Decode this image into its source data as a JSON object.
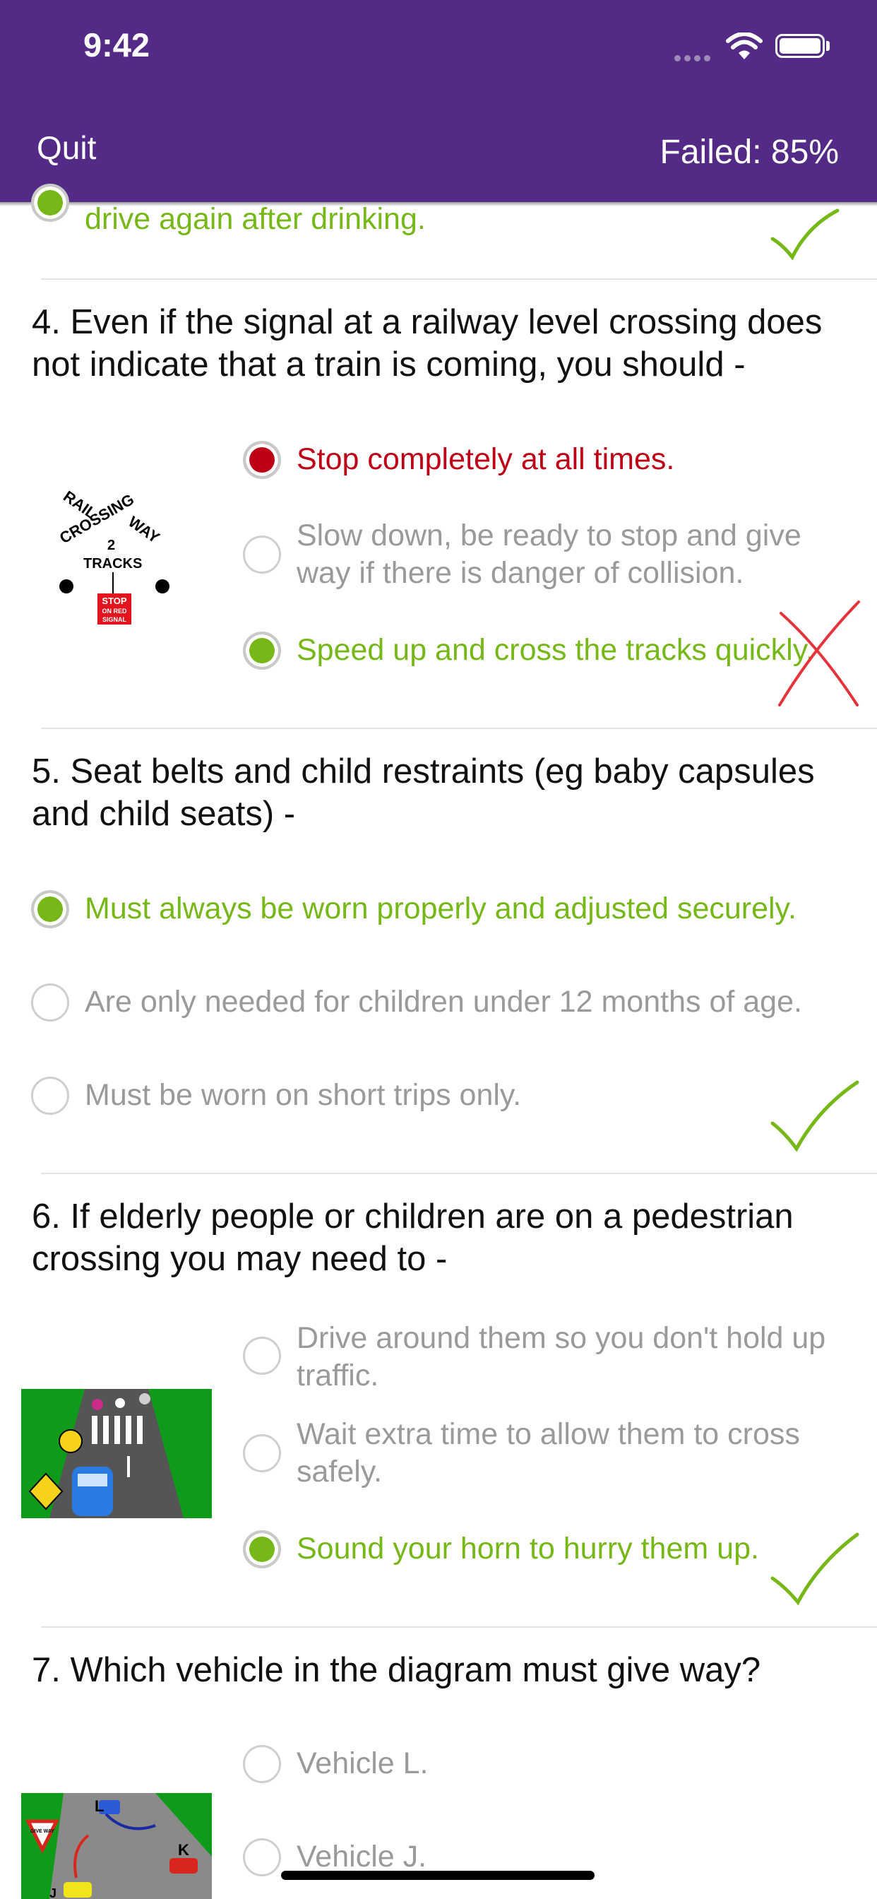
{
  "status": {
    "time": "9:42"
  },
  "header": {
    "quit": "Quit",
    "failed": "Failed: 85%"
  },
  "questions": [
    {
      "partial_answer": "drive again after drinking.",
      "mark": "tick"
    },
    {
      "text": "4. Even if the signal at a railway level crossing does not indicate that a train is coming, you should -",
      "image": {
        "line1": "RAIL",
        "line2": "CROSSING",
        "line3": "WAY",
        "line4": "2",
        "line5": "TRACKS",
        "sign1": "STOP",
        "sign2": "ON RED",
        "sign3": "SIGNAL"
      },
      "answers": [
        {
          "label": "Stop completely at all times.",
          "state": "selected-wrong"
        },
        {
          "label": "Slow down, be ready to stop and give way if there is danger of collision.",
          "state": "unselected"
        },
        {
          "label": "Speed up and cross the tracks quickly.",
          "state": "selected"
        }
      ],
      "mark": "cross"
    },
    {
      "text": "5. Seat belts and child restraints (eg baby capsules and child seats) -",
      "answers": [
        {
          "label": "Must always be worn properly and adjusted securely.",
          "state": "selected"
        },
        {
          "label": "Are only needed for children under 12 months of age.",
          "state": "unselected"
        },
        {
          "label": "Must be worn on short trips only.",
          "state": "unselected"
        }
      ],
      "mark": "tick"
    },
    {
      "text": "6. If elderly people or children are on a pedestrian crossing you may need to -",
      "answers": [
        {
          "label": "Drive around them so you don't hold up traffic.",
          "state": "unselected"
        },
        {
          "label": "Wait extra time to allow them to cross safely.",
          "state": "unselected"
        },
        {
          "label": "Sound your horn to hurry them up.",
          "state": "selected"
        }
      ],
      "mark": "tick"
    },
    {
      "text": "7. Which vehicle in the diagram must give way?",
      "image": {
        "label_l": "L",
        "label_k": "K",
        "label_j": "J",
        "sign": "GIVE WAY"
      },
      "answers": [
        {
          "label": "Vehicle L.",
          "state": "unselected"
        },
        {
          "label": "Vehicle J.",
          "state": "unselected"
        }
      ]
    }
  ],
  "colors": {
    "header": "#532a85",
    "correct": "#76b817",
    "wrong": "#be0016",
    "muted": "#9a9a9a"
  }
}
